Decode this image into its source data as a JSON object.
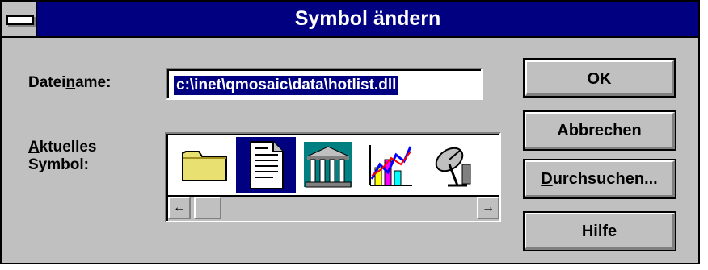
{
  "window": {
    "title": "Symbol ändern"
  },
  "filename": {
    "label_pre": "Datei",
    "label_underline": "n",
    "label_post": "ame:",
    "value": "c:\\inet\\qmosaic\\data\\hotlist.dll"
  },
  "current_symbol": {
    "label_line1_underline": "A",
    "label_line1_rest": "ktuelles",
    "label_line2": "Symbol:"
  },
  "icons": [
    "folder-icon",
    "document-icon",
    "museum-icon",
    "chart-icon",
    "satellite-dish-icon"
  ],
  "scroll": {
    "left_arrow": "←",
    "right_arrow": "→"
  },
  "buttons": {
    "ok": "OK",
    "cancel": "Abbrechen",
    "browse_underline": "D",
    "browse_rest": "urchsuchen...",
    "help": "Hilfe"
  },
  "colors": {
    "titlebar": "#000080",
    "selection": "#000080",
    "face": "#c0c0c0"
  }
}
